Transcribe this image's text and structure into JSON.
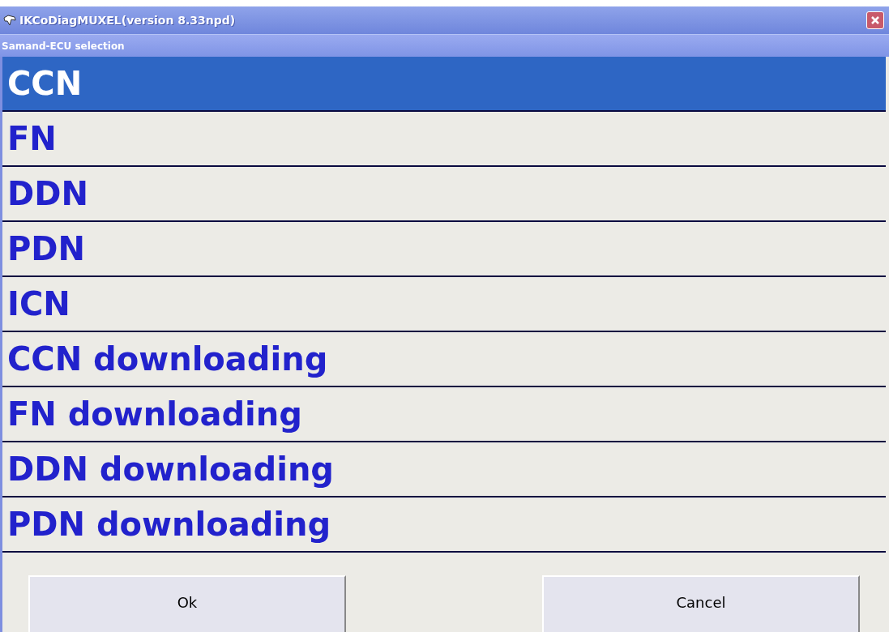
{
  "window": {
    "title": "IKCoDiagMUXEL(version 8.33npd)",
    "subtitle": "Samand-ECU selection"
  },
  "items": [
    {
      "label": "CCN",
      "selected": true
    },
    {
      "label": "FN",
      "selected": false
    },
    {
      "label": "DDN",
      "selected": false
    },
    {
      "label": "PDN",
      "selected": false
    },
    {
      "label": "ICN",
      "selected": false
    },
    {
      "label": "CCN downloading",
      "selected": false
    },
    {
      "label": "FN downloading",
      "selected": false
    },
    {
      "label": "DDN downloading",
      "selected": false
    },
    {
      "label": "PDN downloading",
      "selected": false
    }
  ],
  "buttons": [
    "Ok",
    "Cancel"
  ]
}
